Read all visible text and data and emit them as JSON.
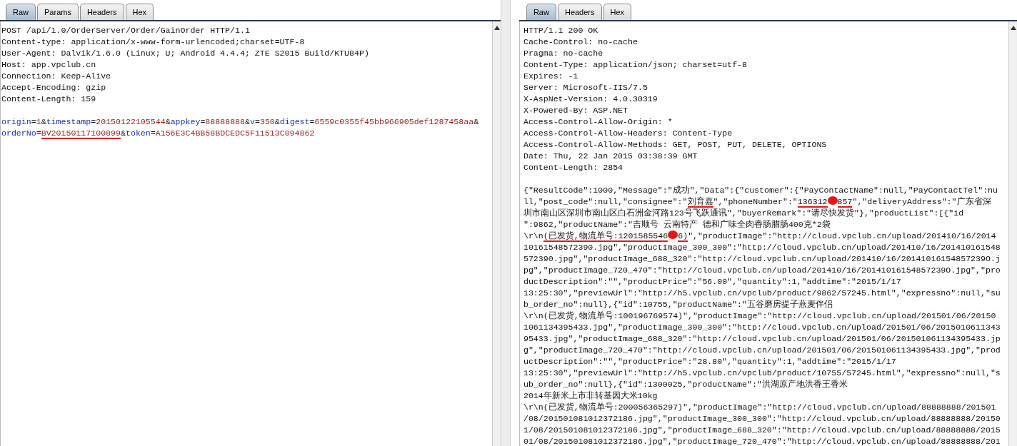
{
  "request_panel": {
    "tabs": [
      {
        "label": "Raw",
        "selected": true
      },
      {
        "label": "Params",
        "selected": false
      },
      {
        "label": "Headers",
        "selected": false
      },
      {
        "label": "Hex",
        "selected": false
      }
    ],
    "headers": [
      "POST /api/1.0/OrderServer/Order/GainOrder HTTP/1.1",
      "Content-type: application/x-www-form-urlencoded;charset=UTF-8",
      "User-Agent: Dalvik/1.6.0 (Linux; U; Android 4.4.4; ZTE S2015 Build/KTU84P)",
      "Host: app.vpclub.cn",
      "Connection: Keep-Alive",
      "Accept-Encoding: gzip",
      "Content-Length: 159"
    ],
    "body": [
      [
        {
          "text": "origin",
          "kind": "name",
          "underlined": false
        },
        {
          "text": "=",
          "kind": "punct",
          "underlined": false
        },
        {
          "text": "1",
          "kind": "value",
          "underlined": false
        },
        {
          "text": "&",
          "kind": "punct",
          "underlined": false
        },
        {
          "text": "timestamp",
          "kind": "name",
          "underlined": false
        },
        {
          "text": "=",
          "kind": "punct",
          "underlined": false
        },
        {
          "text": "20150122105544",
          "kind": "value",
          "underlined": false
        },
        {
          "text": "&",
          "kind": "punct",
          "underlined": false
        },
        {
          "text": "appkey",
          "kind": "name",
          "underlined": false
        },
        {
          "text": "=",
          "kind": "punct",
          "underlined": false
        },
        {
          "text": "88888888",
          "kind": "value",
          "underlined": false
        },
        {
          "text": "&",
          "kind": "punct",
          "underlined": false
        },
        {
          "text": "v",
          "kind": "name",
          "underlined": false
        },
        {
          "text": "=",
          "kind": "punct",
          "underlined": false
        },
        {
          "text": "350",
          "kind": "value",
          "underlined": false
        },
        {
          "text": "&",
          "kind": "punct",
          "underlined": false
        },
        {
          "text": "digest",
          "kind": "name",
          "underlined": false
        },
        {
          "text": "=",
          "kind": "punct",
          "underlined": false
        },
        {
          "text": "6559c0355f45bb966905def1287458aa",
          "kind": "value",
          "underlined": false
        },
        {
          "text": "&",
          "kind": "punct",
          "underlined": false
        }
      ],
      [
        {
          "text": "orderNo",
          "kind": "name",
          "underlined": false
        },
        {
          "text": "=",
          "kind": "punct",
          "underlined": false
        },
        {
          "text": "BV20150117100899",
          "kind": "value",
          "underlined": true
        },
        {
          "text": "&",
          "kind": "punct",
          "underlined": false
        },
        {
          "text": "token",
          "kind": "name",
          "underlined": false
        },
        {
          "text": "=",
          "kind": "punct",
          "underlined": false
        },
        {
          "text": "A156E3C4BB58BDCEDC5F11513C094862",
          "kind": "value",
          "underlined": false
        }
      ]
    ]
  },
  "response_panel": {
    "tabs": [
      {
        "label": "Raw",
        "selected": true
      },
      {
        "label": "Headers",
        "selected": false
      },
      {
        "label": "Hex",
        "selected": false
      }
    ],
    "headers": [
      "HTTP/1.1 200 OK",
      "Cache-Control: no-cache",
      "Pragma: no-cache",
      "Content-Type: application/json; charset=utf-8",
      "Expires: -1",
      "Server: Microsoft-IIS/7.5",
      "X-AspNet-Version: 4.0.30319",
      "X-Powered-By: ASP.NET",
      "Access-Control-Allow-Origin: *",
      "Access-Control-Allow-Headers: Content-Type",
      "Access-Control-Allow-Methods: GET, POST, PUT, DELETE, OPTIONS",
      "Date: Thu, 22 Jan 2015 03:38:39 GMT",
      "Content-Length: 2854"
    ],
    "body": [
      "{\"ResultCode\":1000,\"Message\":\"成功\",\"Data\":{\"customer\":{\"PayContactName\":null,\"PayContactTel\":nu",
      [
        {
          "kind": "text",
          "text": "ll,\"post_code\":null,\"consignee\":\"",
          "underlined": false
        },
        {
          "kind": "text",
          "text": "刘育嘉",
          "underlined": true
        },
        {
          "kind": "text",
          "text": "\",\"phoneNumber\":\"",
          "underlined": false
        },
        {
          "kind": "text",
          "text": "136312",
          "underlined": true
        },
        {
          "kind": "redaction",
          "underlined": true
        },
        {
          "kind": "text",
          "text": "857",
          "underlined": true
        },
        {
          "kind": "text",
          "text": "\",\"deliveryAddress\":\"广东省深",
          "underlined": false
        }
      ],
      "圳市南山区深圳市南山区白石洲金河路123号飞跃通讯\",\"buyerRemark\":\"请尽快发货\"},\"productList\":[{\"id",
      "\":9862,\"productName\":\"吉顺号 云南特产 德和广味全肉香肠腊肠400克*2袋",
      [
        {
          "kind": "text",
          "text": "\\r\\n",
          "underlined": false
        },
        {
          "kind": "text",
          "text": "(已发货,物流单号:1201585546",
          "underlined": true
        },
        {
          "kind": "redaction",
          "underlined": true
        },
        {
          "kind": "text",
          "text": "6)",
          "underlined": true
        },
        {
          "kind": "text",
          "text": "\",\"productImage\":\"http://cloud.vpclub.cn/upload/201410/16/2014",
          "underlined": false
        }
      ],
      "10161548572390.jpg\",\"productImage_300_300\":\"http://cloud.vpclub.cn/upload/201410/16/201410161548",
      "572390.jpg\",\"productImage_688_320\":\"http://cloud.vpclub.cn/upload/201410/16/20141016154857239O.j",
      "pg\",\"productImage_720_470\":\"http://cloud.vpclub.cn/upload/201410/16/20141016154857239O.jpg\",\"pro",
      "ductDescription\":\"\",\"productPrice\":\"56.00\",\"quantity\":1,\"addtime\":\"2015/1/17",
      "13:25:30\",\"previewUrl\":\"http://h5.vpclub.cn/vpclub/product/9862/57245.html\",\"expressno\":null,\"su",
      "b_order_no\":null},{\"id\":10755,\"productName\":\"五谷磨房提子燕麦伴侣",
      "\\r\\n(已发货,物流单号:100196769574)\",\"productImage\":\"http://cloud.vpclub.cn/upload/201501/06/20150",
      "1061134395433.jpg\",\"productImage_300_300\":\"http://cloud.vpclub.cn/upload/201501/06/2015010611343",
      "95433.jpg\",\"productImage_688_320\":\"http://cloud.vpclub.cn/upload/201501/06/201501061134395433.jp",
      "g\",\"productImage_720_470\":\"http://cloud.vpclub.cn/upload/201501/06/201501061134395433.jpg\",\"prod",
      "uctDescription\":\"\",\"productPrice\":\"28.80\",\"quantity\":1,\"addtime\":\"2015/1/17",
      "13:25:30\",\"previewUrl\":\"http://h5.vpclub.cn/vpclub/product/10755/57245.html\",\"expressno\":null,\"s",
      "ub_order_no\":null},{\"id\":1300025,\"productName\":\"洪湖原产地洪香王香米",
      "2014年新米上市非转基因大米10kg",
      "\\r\\n(已发货,物流单号:200056365297)\",\"productImage\":\"http://cloud.vpclub.cn/upload/88888888/201501",
      "/08/201501081012372186.jpg\",\"productImage_300_300\":\"http://cloud.vpclub.cn/upload/88888888/20150",
      "1/08/201501081012372186.jpg\",\"productImage_688_320\":\"http://cloud.vpclub.cn/upload/88888888/2015",
      "01/08/201501081012372186.jpg\",\"productImage_720_470\":\"http://cloud.vpclub.cn/upload/88888888/201"
    ]
  }
}
